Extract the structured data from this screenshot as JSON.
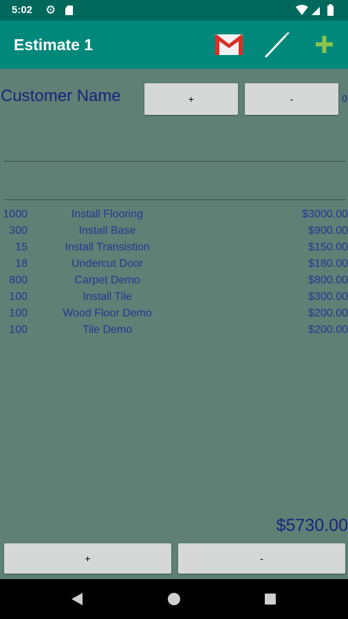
{
  "status_bar": {
    "time": "5:02"
  },
  "app_bar": {
    "title": "Estimate 1"
  },
  "customer": {
    "label": "Customer Name",
    "add_label": "+",
    "remove_label": "-",
    "side_value": "0"
  },
  "items": [
    {
      "qty": "1000",
      "description": "Install Flooring",
      "price": "$3000.00"
    },
    {
      "qty": "300",
      "description": "Install Base",
      "price": "$900.00"
    },
    {
      "qty": "15",
      "description": "Install Transistion",
      "price": "$150.00"
    },
    {
      "qty": "18",
      "description": "Undercut Door",
      "price": "$180.00"
    },
    {
      "qty": "800",
      "description": "Carpet Demo",
      "price": "$800.00"
    },
    {
      "qty": "100",
      "description": "Install Tile",
      "price": "$300.00"
    },
    {
      "qty": "100",
      "description": "Wood Floor Demo",
      "price": "$200.00"
    },
    {
      "qty": "100",
      "description": "Tile Demo",
      "price": "$200.00"
    }
  ],
  "total": "$5730.00",
  "bottom_buttons": {
    "add_label": "+",
    "remove_label": "-"
  },
  "colors": {
    "app_bar": "#00897b",
    "status_bar": "#00695c",
    "background": "#5e8075",
    "text": "#1a237e",
    "button": "#d6d7d7"
  }
}
